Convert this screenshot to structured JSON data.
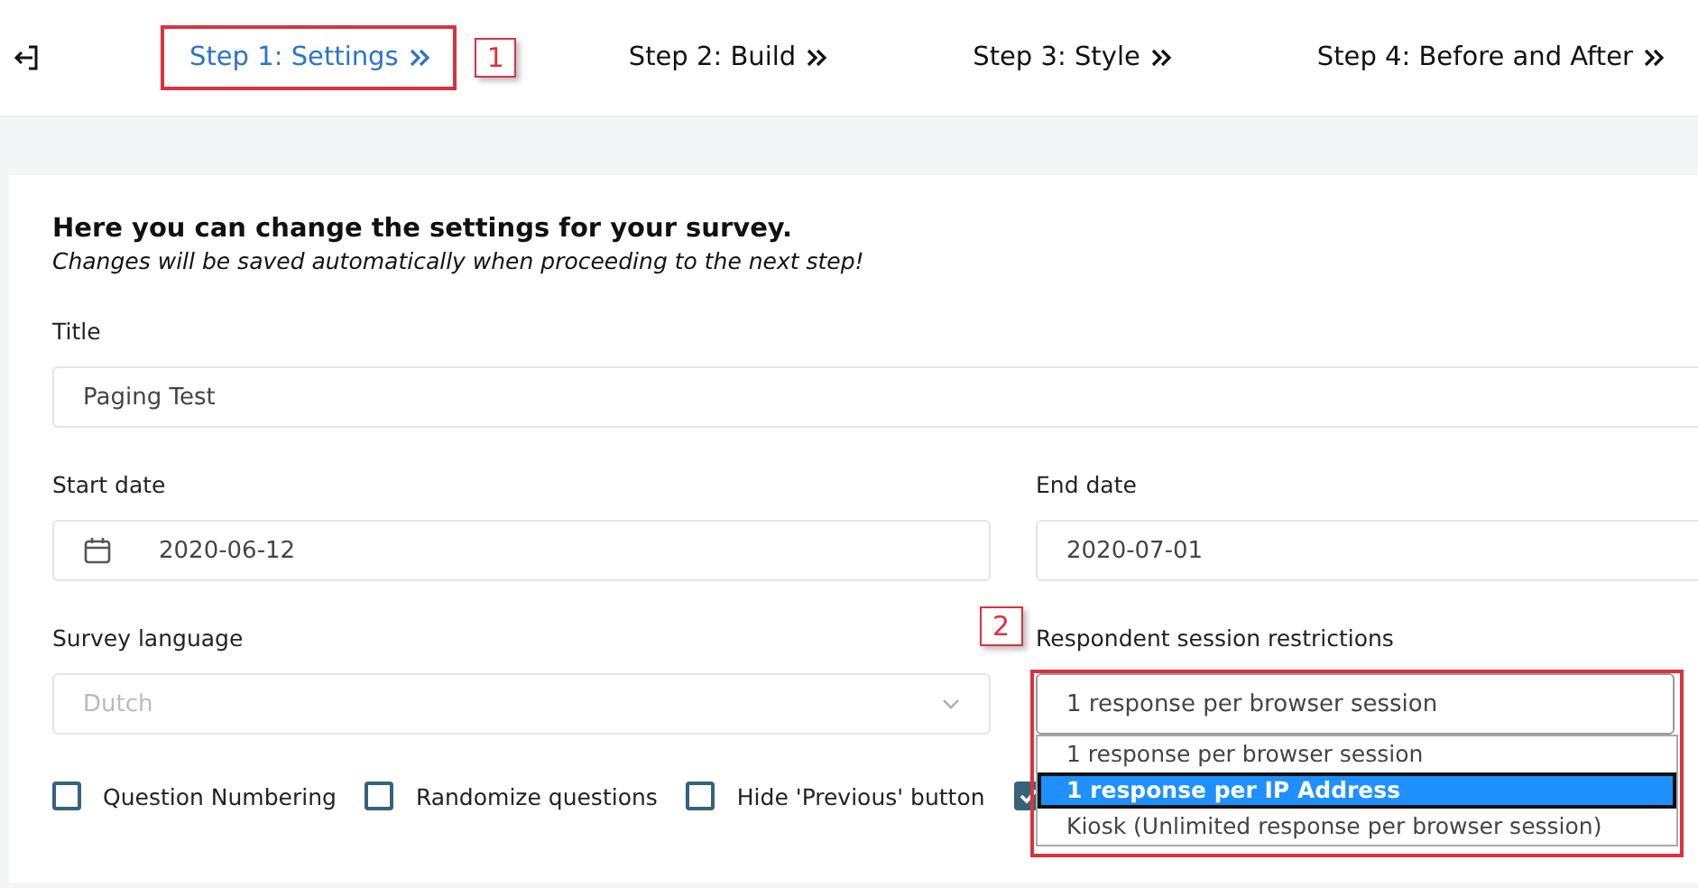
{
  "steps": [
    {
      "label": "Step 1: Settings",
      "selected": true,
      "callout": "1"
    },
    {
      "label": "Step 2: Build",
      "selected": false
    },
    {
      "label": "Step 3: Style",
      "selected": false
    },
    {
      "label": "Step 4: Before and After",
      "selected": false
    }
  ],
  "intro": {
    "heading": "Here you can change the settings for your survey.",
    "note": "Changes will be saved automatically when proceeding to the next step!"
  },
  "title_field": {
    "label": "Title",
    "value": "Paging Test"
  },
  "start_date": {
    "label": "Start date",
    "value": "2020-06-12"
  },
  "end_date": {
    "label": "End date",
    "value": "2020-07-01"
  },
  "language": {
    "label": "Survey language",
    "value": "Dutch",
    "disabled": true
  },
  "restriction": {
    "label": "Respondent session restrictions",
    "value": "1 response per browser session",
    "expanded": true,
    "callout": "2",
    "options": [
      {
        "label": "1 response per browser session",
        "highlighted": false
      },
      {
        "label": "1 response per IP Address",
        "highlighted": true
      },
      {
        "label": "Kiosk (Unlimited response per browser session)",
        "highlighted": false
      }
    ]
  },
  "checkboxes": [
    {
      "label": "Question Numbering",
      "checked": false
    },
    {
      "label": "Randomize questions",
      "checked": false
    },
    {
      "label": "Hide 'Previous' button",
      "checked": false
    },
    {
      "checked": true
    }
  ]
}
